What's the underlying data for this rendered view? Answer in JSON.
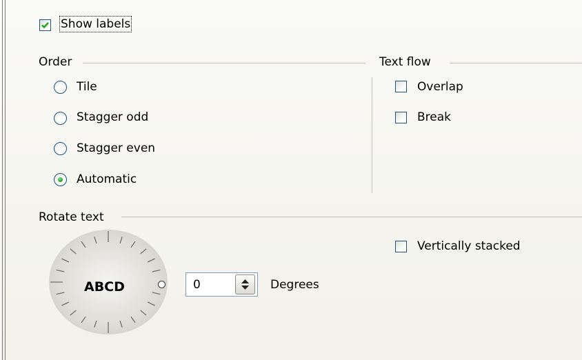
{
  "show_labels": {
    "label": "Show labels",
    "checked": true
  },
  "order": {
    "title": "Order",
    "options": [
      {
        "label": "Tile",
        "selected": false
      },
      {
        "label": "Stagger odd",
        "selected": false
      },
      {
        "label": "Stagger even",
        "selected": false
      },
      {
        "label": "Automatic",
        "selected": true
      }
    ]
  },
  "text_flow": {
    "title": "Text flow",
    "overlap": {
      "label": "Overlap",
      "checked": false
    },
    "break": {
      "label": "Break",
      "checked": false
    }
  },
  "rotate_text": {
    "title": "Rotate text",
    "dial_text": "ABCD",
    "degrees_value": "0",
    "degrees_label": "Degrees",
    "vertically_stacked": {
      "label": "Vertically stacked",
      "checked": false
    }
  },
  "colors": {
    "accent": "#21a121",
    "control_border": "#1c5180",
    "frame_line": "#c3c2b8"
  }
}
